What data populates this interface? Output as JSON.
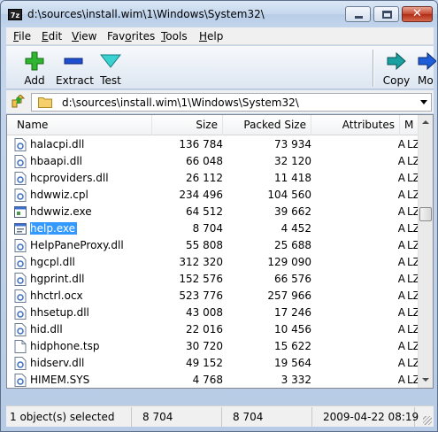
{
  "window": {
    "title": "d:\\sources\\install.wim\\1\\Windows\\System32\\",
    "app_icon_text": "7z",
    "close_glyph": "✕"
  },
  "menu": [
    {
      "label": "File",
      "accel": "F",
      "rest": "ile"
    },
    {
      "label": "Edit",
      "accel": "E",
      "rest": "dit"
    },
    {
      "label": "View",
      "accel": "V",
      "rest": "iew"
    },
    {
      "label": "Favorites",
      "accel": "F",
      "rest": "avorites",
      "pre": "Fav",
      "accel_mid": "o",
      "post": "rites"
    },
    {
      "label": "Tools",
      "accel": "T",
      "rest": "ools"
    },
    {
      "label": "Help",
      "accel": "H",
      "rest": "elp"
    }
  ],
  "toolbar": {
    "add_label": "Add",
    "extract_label": "Extract",
    "test_label": "Test",
    "copy_label": "Copy",
    "move_label": "Mo"
  },
  "address": {
    "path": "d:\\sources\\install.wim\\1\\Windows\\System32\\"
  },
  "columns": {
    "name": "Name",
    "size": "Size",
    "packed": "Packed Size",
    "attributes": "Attributes",
    "method": "M"
  },
  "files": [
    {
      "name": "halacpi.dll",
      "size": "136 784",
      "packed": "73 934",
      "attr": "A",
      "method": "LZ",
      "icon": "dll-file-icon"
    },
    {
      "name": "hbaapi.dll",
      "size": "66 048",
      "packed": "32 120",
      "attr": "A",
      "method": "LZ",
      "icon": "dll-file-icon"
    },
    {
      "name": "hcproviders.dll",
      "size": "26 112",
      "packed": "11 418",
      "attr": "A",
      "method": "LZ",
      "icon": "dll-file-icon"
    },
    {
      "name": "hdwwiz.cpl",
      "size": "234 496",
      "packed": "104 560",
      "attr": "A",
      "method": "LZ",
      "icon": "dll-file-icon"
    },
    {
      "name": "hdwwiz.exe",
      "size": "64 512",
      "packed": "39 662",
      "attr": "A",
      "method": "LZ",
      "icon": "exe-file-icon"
    },
    {
      "name": "help.exe",
      "size": "8 704",
      "packed": "4 452",
      "attr": "A",
      "method": "LZ",
      "icon": "exe-file-icon",
      "selected": true
    },
    {
      "name": "HelpPaneProxy.dll",
      "size": "55 808",
      "packed": "25 688",
      "attr": "A",
      "method": "LZ",
      "icon": "dll-file-icon"
    },
    {
      "name": "hgcpl.dll",
      "size": "312 320",
      "packed": "129 090",
      "attr": "A",
      "method": "LZ",
      "icon": "dll-file-icon"
    },
    {
      "name": "hgprint.dll",
      "size": "152 576",
      "packed": "66 576",
      "attr": "A",
      "method": "LZ",
      "icon": "dll-file-icon"
    },
    {
      "name": "hhctrl.ocx",
      "size": "523 776",
      "packed": "257 966",
      "attr": "A",
      "method": "LZ",
      "icon": "dll-file-icon"
    },
    {
      "name": "hhsetup.dll",
      "size": "43 008",
      "packed": "17 246",
      "attr": "A",
      "method": "LZ",
      "icon": "dll-file-icon"
    },
    {
      "name": "hid.dll",
      "size": "22 016",
      "packed": "10 456",
      "attr": "A",
      "method": "LZ",
      "icon": "dll-file-icon"
    },
    {
      "name": "hidphone.tsp",
      "size": "30 720",
      "packed": "15 622",
      "attr": "A",
      "method": "LZ",
      "icon": "blank-file-icon"
    },
    {
      "name": "hidserv.dll",
      "size": "49 152",
      "packed": "19 564",
      "attr": "A",
      "method": "LZ",
      "icon": "dll-file-icon"
    },
    {
      "name": "HIMEM.SYS",
      "size": "4 768",
      "packed": "3 332",
      "attr": "A",
      "method": "LZ",
      "icon": "sys-file-icon"
    }
  ],
  "status": {
    "selection": "1 object(s) selected",
    "size": "8 704",
    "packed": "8 704",
    "modified": "2009-04-22 08:19"
  }
}
